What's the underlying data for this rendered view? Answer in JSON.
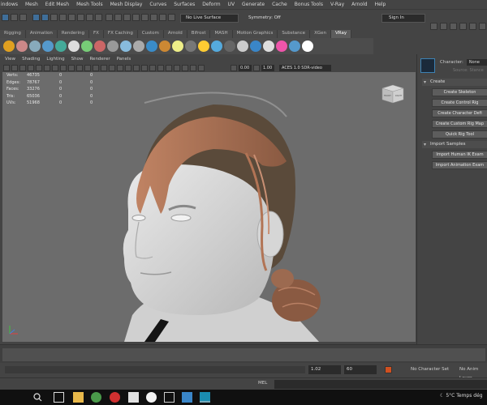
{
  "menubar": {
    "items": [
      "indows",
      "Mesh",
      "Edit Mesh",
      "Mesh Tools",
      "Mesh Display",
      "Curves",
      "Surfaces",
      "Deform",
      "UV",
      "Generate",
      "Cache",
      "Bonus Tools",
      "V-Ray",
      "Arnold",
      "Help"
    ]
  },
  "status_line": {
    "live_surface": "No Live Surface",
    "symmetry": "Symmetry: Off",
    "sign_in": "Sign In"
  },
  "shelf": {
    "tabs": [
      "Rigging",
      "Animation",
      "Rendering",
      "FX",
      "FX Caching",
      "Custom",
      "Arnold",
      "Bifrost",
      "MASH",
      "Motion Graphics",
      "Substance",
      "XGen",
      "VRay"
    ],
    "active_tab": "VRay"
  },
  "panel": {
    "menu": [
      "View",
      "Shading",
      "Lighting",
      "Show",
      "Renderer",
      "Panels"
    ],
    "exposure": "0.00",
    "gamma": "1.00",
    "color_space": "ACES 1.0 SDR-video (sRGB"
  },
  "hud": {
    "rows": [
      {
        "label": "Verts:",
        "v1": "46735",
        "v2": "0",
        "v3": "0"
      },
      {
        "label": "Edges:",
        "v1": "78767",
        "v2": "0",
        "v3": "0"
      },
      {
        "label": "Faces:",
        "v1": "33276",
        "v2": "0",
        "v3": "0"
      },
      {
        "label": "Tris:",
        "v1": "65036",
        "v2": "0",
        "v3": "0"
      },
      {
        "label": "UVs:",
        "v1": "51968",
        "v2": "0",
        "v3": "0"
      }
    ]
  },
  "viewcube": {
    "front": "FRONT",
    "right": "RIGHT"
  },
  "hik": {
    "character_label": "Character:",
    "character_value": "None",
    "source_label": "Source:",
    "source_value": "Stance",
    "create_section": "Create",
    "create_buttons": [
      "Create Skeleton",
      "Create Control Rig",
      "Create Character Defi",
      "Create Custom Rig Map",
      "Quick Rig Tool"
    ],
    "import_section": "Import Samples",
    "import_buttons": [
      "Import Human IK Exam",
      "Import Animation Exam"
    ]
  },
  "range": {
    "start": "1.02",
    "end": "60",
    "character_set": "No Character Set",
    "anim_layer": "No Anim Layer"
  },
  "command_line": {
    "label": "MEL"
  },
  "taskbar": {
    "weather": "5°C",
    "weather_text": "Temps dég"
  },
  "colors": {
    "accent_blue": "#3f6e99",
    "ui_bg": "#444444",
    "viewport_bg": "#6c6c6c",
    "hair": "#b97a5c"
  }
}
